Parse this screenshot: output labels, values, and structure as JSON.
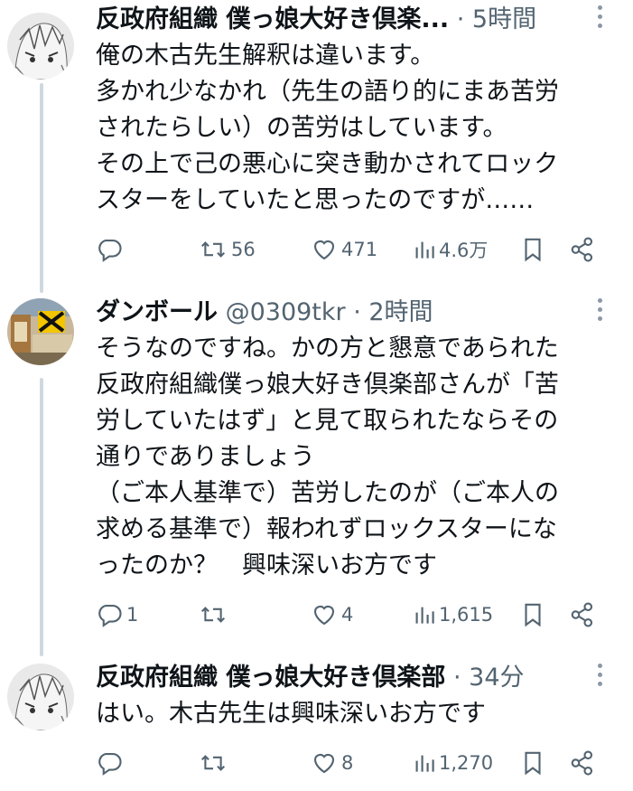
{
  "tweets": [
    {
      "name": "反政府組織 僕っ娘大好き倶楽...",
      "handle": "",
      "meta": " · 5時間",
      "lines": [
        "俺の木古先生解釈は違います。",
        "多かれ少なかれ（先生の語り的にまあ苦労",
        "されたらしい）の苦労はしています。",
        "その上で己の悪心に突き動かされてロック",
        "スターをしていたと思ったのですが……"
      ],
      "actions": {
        "reply": "",
        "retweet": "56",
        "like": "471",
        "views": "4.6万"
      }
    },
    {
      "name": "ダンボール",
      "handle": " @0309tkr",
      "meta": " · 2時間",
      "lines": [
        "そうなのですね。かの方と懇意であられた",
        "反政府組織僕っ娘大好き倶楽部さんが「苦",
        "労していたはず」と見て取られたならその",
        "通りでありましょう",
        "（ご本人基準で）苦労したのが（ご本人の",
        "求める基準で）報われずロックスターにな",
        "ったのか？　興味深いお方です"
      ],
      "actions": {
        "reply": "1",
        "retweet": "",
        "like": "4",
        "views": "1,615"
      }
    },
    {
      "name": "反政府組織 僕っ娘大好き倶楽部",
      "handle": "",
      "meta": " · 34分",
      "lines": [
        "はい。木古先生は興味深いお方です"
      ],
      "actions": {
        "reply": "",
        "retweet": "",
        "like": "8",
        "views": "1,270"
      }
    }
  ],
  "colors": {
    "text": "#0f1419",
    "secondary": "#536471",
    "thread_line": "#cfd9de"
  },
  "icons": [
    "reply-icon",
    "retweet-icon",
    "like-icon",
    "views-icon",
    "bookmark-icon",
    "share-icon",
    "more-icon"
  ]
}
